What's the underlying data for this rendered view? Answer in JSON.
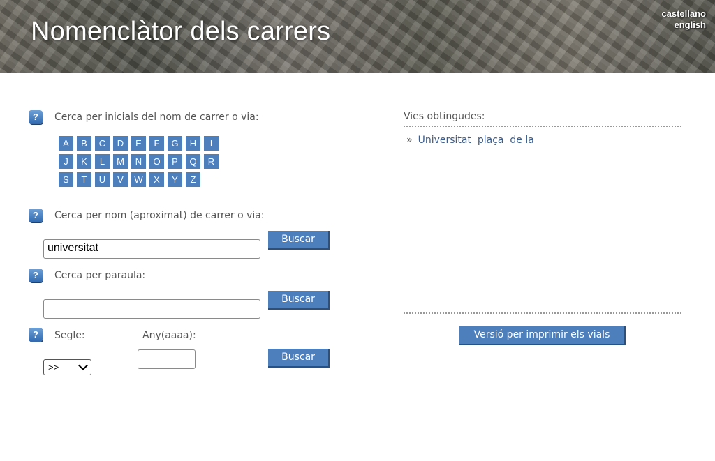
{
  "header": {
    "title": "Nomenclàtor dels carrers",
    "lang_castellano": "castellano",
    "lang_english": "english"
  },
  "help_icon": "?",
  "search_initials": {
    "label": "Cerca per inicials del nom de carrer o via:",
    "letters": [
      "A",
      "B",
      "C",
      "D",
      "E",
      "F",
      "G",
      "H",
      "I",
      "J",
      "K",
      "L",
      "M",
      "N",
      "O",
      "P",
      "Q",
      "R",
      "S",
      "T",
      "U",
      "V",
      "W",
      "X",
      "Y",
      "Z"
    ]
  },
  "search_name": {
    "label": "Cerca per nom (aproximat) de carrer o via:",
    "value": "universitat",
    "button": "Buscar"
  },
  "search_word": {
    "label": "Cerca per paraula:",
    "value": "",
    "button": "Buscar"
  },
  "search_century": {
    "segle_label": "Segle:",
    "segle_value": ">>",
    "any_label": "Any(aaaa):",
    "any_value": "",
    "button": "Buscar"
  },
  "results": {
    "heading": "Vies obtingudes:",
    "bullet": "»",
    "items": [
      "Universitat  plaça  de la"
    ],
    "print_button": "Versió per imprimir els vials"
  }
}
